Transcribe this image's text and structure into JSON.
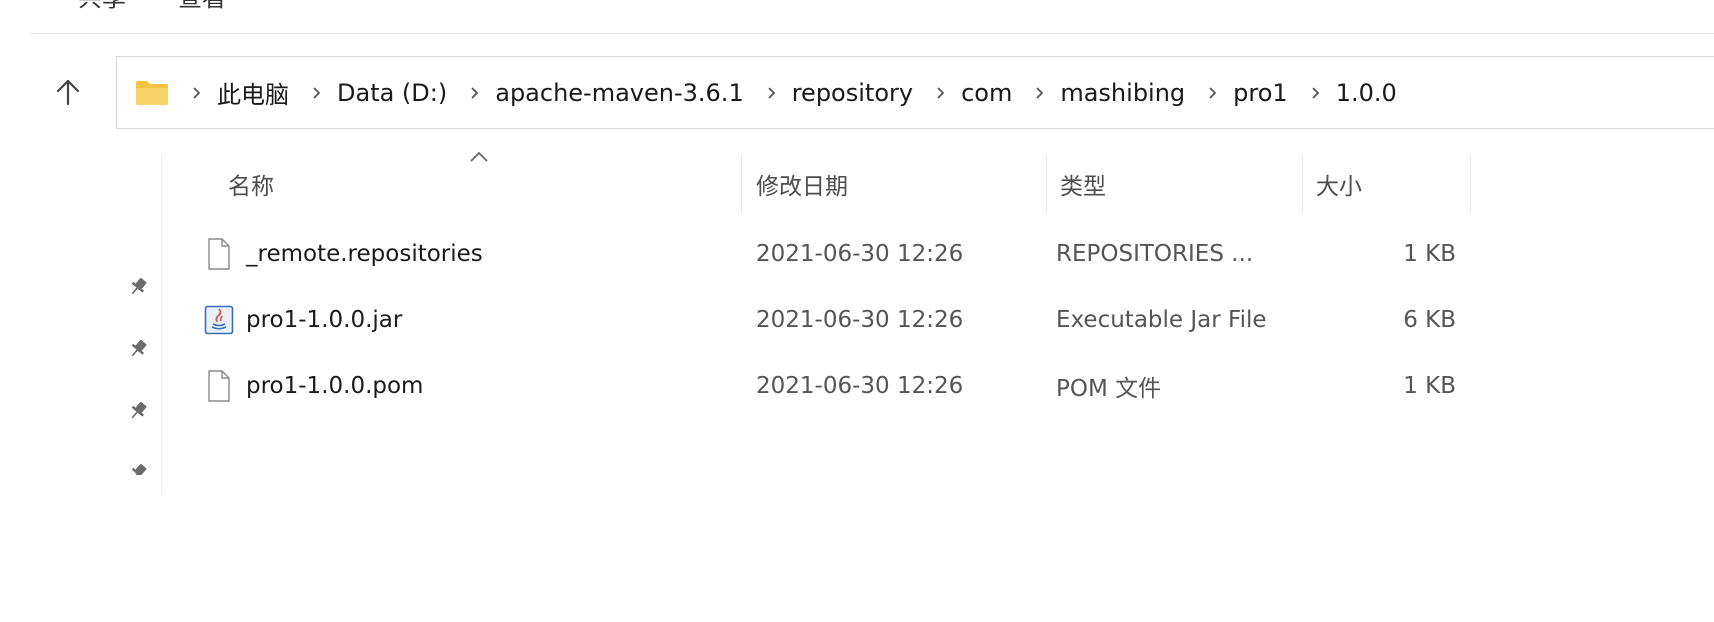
{
  "ribbon": {
    "tabs": [
      "共享",
      "查看"
    ]
  },
  "address_bar": {
    "folder_icon": "folder-icon",
    "crumbs": [
      "此电脑",
      "Data (D:)",
      "apache-maven-3.6.1",
      "repository",
      "com",
      "mashibing",
      "pro1",
      "1.0.0"
    ]
  },
  "columns": {
    "name": "名称",
    "date": "修改日期",
    "type": "类型",
    "size": "大小",
    "sorted_by": "name"
  },
  "files": [
    {
      "icon": "file-icon",
      "name": "_remote.repositories",
      "date": "2021-06-30 12:26",
      "type": "REPOSITORIES ...",
      "size": "1 KB"
    },
    {
      "icon": "java-jar-icon",
      "name": "pro1-1.0.0.jar",
      "date": "2021-06-30 12:26",
      "type": "Executable Jar File",
      "size": "6 KB"
    },
    {
      "icon": "file-icon",
      "name": "pro1-1.0.0.pom",
      "date": "2021-06-30 12:26",
      "type": "POM 文件",
      "size": "1 KB"
    }
  ],
  "colors": {
    "folder": "#f6c342",
    "jar_icon": "#3b6fb6"
  }
}
